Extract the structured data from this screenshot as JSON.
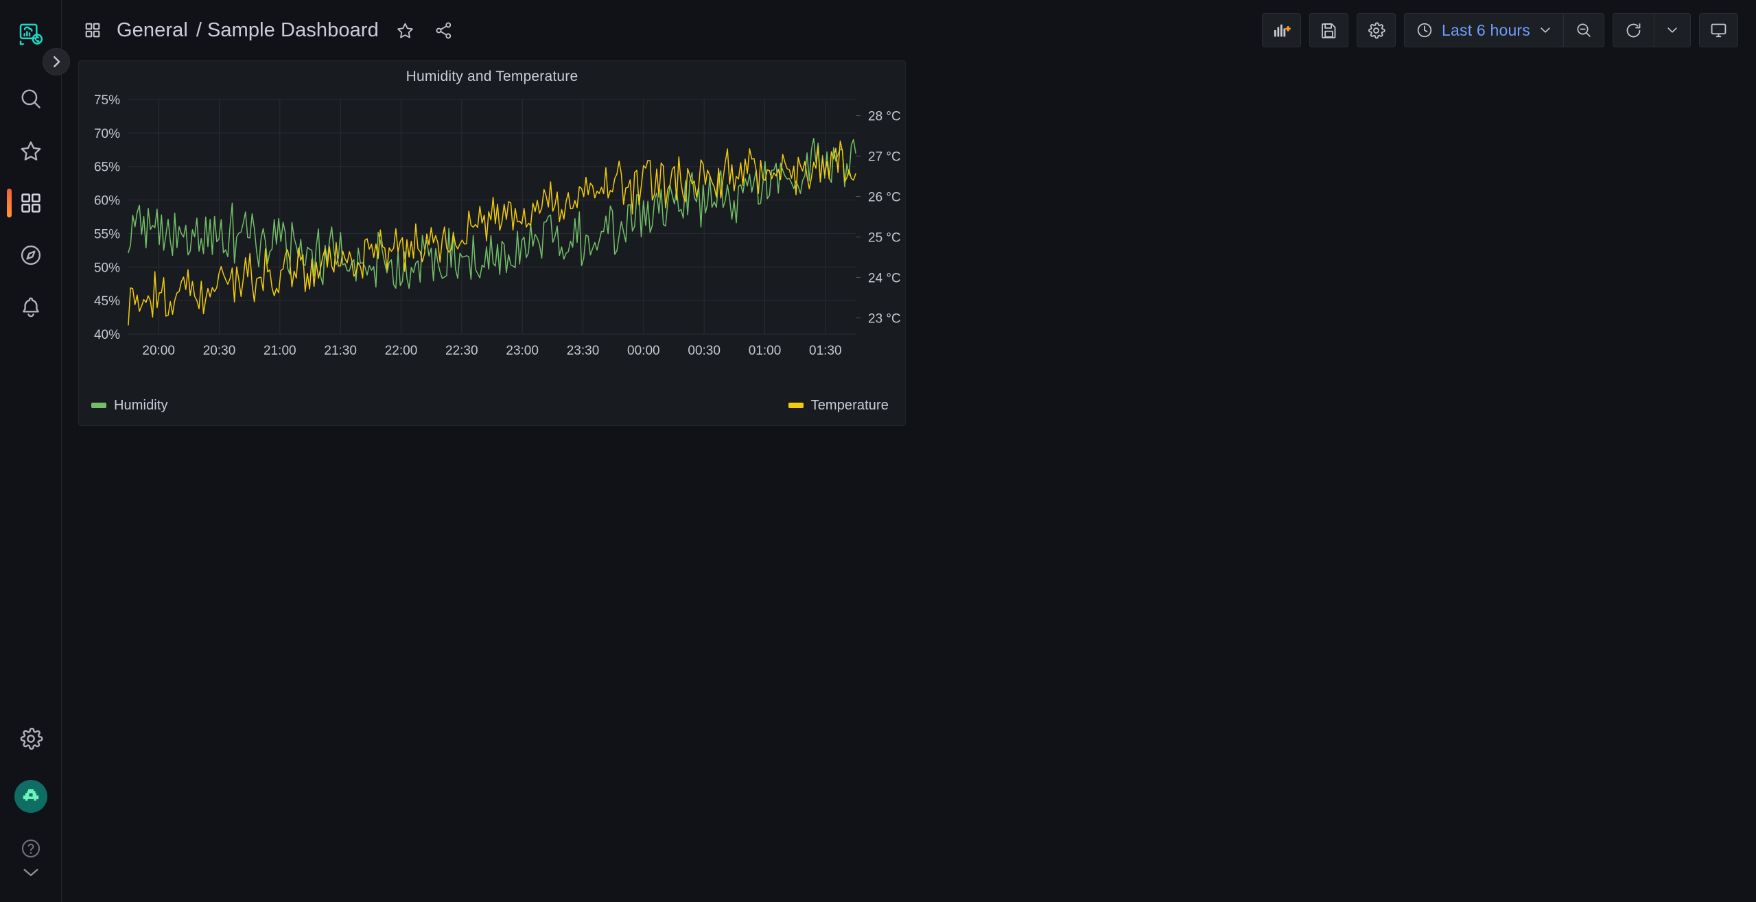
{
  "nav": {
    "logo_icon": "grafana-logo-icon",
    "expand_button_icon": "chevron-right-icon",
    "items": [
      {
        "id": "search",
        "label": "Search",
        "icon": "search-icon",
        "active": false
      },
      {
        "id": "starred",
        "label": "Starred",
        "icon": "star-icon",
        "active": false
      },
      {
        "id": "dashboards",
        "label": "Dashboards",
        "icon": "apps-grid-icon",
        "active": true
      },
      {
        "id": "explore",
        "label": "Explore",
        "icon": "compass-icon",
        "active": false
      },
      {
        "id": "alerting",
        "label": "Alerting",
        "icon": "bell-icon",
        "active": false
      }
    ],
    "bottom": [
      {
        "id": "configuration",
        "label": "Configuration",
        "icon": "gear-icon"
      },
      {
        "id": "profile",
        "label": "Profile",
        "icon": "avatar-robot-icon"
      },
      {
        "id": "help",
        "label": "Help",
        "icon": "question-circle-icon"
      }
    ]
  },
  "header": {
    "grid_icon": "apps-grid-icon",
    "folder": "General",
    "separator": "/",
    "title": "Sample Dashboard",
    "star_icon": "star-outline-icon",
    "share_icon": "share-nodes-icon"
  },
  "toolbar": {
    "add_panel": {
      "label": "Add panel",
      "icon": "add-panel-icon"
    },
    "save": {
      "label": "Save dashboard",
      "icon": "save-floppy-icon"
    },
    "settings": {
      "label": "Dashboard settings",
      "icon": "gear-icon"
    },
    "time_range": {
      "label": "Last 6 hours",
      "icon": "clock-icon",
      "chevron": "chevron-down-icon"
    },
    "zoom_out": {
      "label": "Zoom out time range",
      "icon": "zoom-out-icon"
    },
    "refresh": {
      "label": "Refresh dashboard",
      "icon": "refresh-icon",
      "chevron": "chevron-down-icon"
    },
    "kiosk": {
      "label": "Cycle view mode",
      "icon": "monitor-icon"
    }
  },
  "panel": {
    "title": "Humidity and Temperature",
    "legend": [
      {
        "name": "Humidity",
        "color": "#73bf69",
        "align": "left"
      },
      {
        "name": "Temperature",
        "color": "#f2cc0c",
        "align": "right"
      }
    ]
  },
  "chart_data": {
    "type": "line",
    "title": "Humidity and Temperature",
    "xlabel": "",
    "grid": true,
    "legend_position": "bottom",
    "x_ticks": [
      "20:00",
      "20:30",
      "21:00",
      "21:30",
      "22:00",
      "22:30",
      "23:00",
      "23:30",
      "00:00",
      "00:30",
      "01:00",
      "01:30"
    ],
    "axes": [
      {
        "id": "left",
        "ylabel": "Humidity",
        "unit": "%",
        "ylim": [
          40,
          75
        ],
        "ticks": [
          40,
          45,
          50,
          55,
          60,
          65,
          70,
          75
        ],
        "tick_labels": [
          "40%",
          "45%",
          "50%",
          "55%",
          "60%",
          "65%",
          "70%",
          "75%"
        ]
      },
      {
        "id": "right",
        "ylabel": "Temperature",
        "unit": "°C",
        "ylim": [
          22.6,
          28.4
        ],
        "ticks": [
          23,
          24,
          25,
          26,
          27,
          28
        ],
        "tick_labels": [
          "23 °C",
          "24 °C",
          "25 °C",
          "26 °C",
          "27 °C",
          "28 °C"
        ]
      }
    ],
    "series": [
      {
        "name": "Humidity",
        "color": "#73bf69",
        "axis": "left",
        "unit": "%",
        "noise": 3.6,
        "seed": 7,
        "trend": [
          [
            0.0,
            57.0
          ],
          [
            0.03,
            56.6
          ],
          [
            0.06,
            55.8
          ],
          [
            0.1,
            55.0
          ],
          [
            0.14,
            54.3
          ],
          [
            0.18,
            53.6
          ],
          [
            0.22,
            53.0
          ],
          [
            0.26,
            52.4
          ],
          [
            0.3,
            52.0
          ],
          [
            0.34,
            51.6
          ],
          [
            0.38,
            51.4
          ],
          [
            0.42,
            51.4
          ],
          [
            0.46,
            51.6
          ],
          [
            0.5,
            52.0
          ],
          [
            0.54,
            52.6
          ],
          [
            0.58,
            53.4
          ],
          [
            0.62,
            54.4
          ],
          [
            0.66,
            55.6
          ],
          [
            0.7,
            57.0
          ],
          [
            0.74,
            58.4
          ],
          [
            0.78,
            59.8
          ],
          [
            0.82,
            61.2
          ],
          [
            0.86,
            62.4
          ],
          [
            0.9,
            63.4
          ],
          [
            0.94,
            64.4
          ],
          [
            0.97,
            65.2
          ],
          [
            1.0,
            65.8
          ]
        ]
      },
      {
        "name": "Temperature",
        "color": "#f2cc0c",
        "axis": "right",
        "unit": "°C",
        "noise": 2.9,
        "seed": 23,
        "trend_as_left_scale": [
          [
            0.0,
            44.6
          ],
          [
            0.03,
            45.2
          ],
          [
            0.06,
            46.0
          ],
          [
            0.1,
            46.8
          ],
          [
            0.14,
            47.6
          ],
          [
            0.18,
            48.4
          ],
          [
            0.22,
            49.2
          ],
          [
            0.26,
            50.2
          ],
          [
            0.3,
            51.2
          ],
          [
            0.34,
            52.2
          ],
          [
            0.38,
            53.2
          ],
          [
            0.42,
            54.4
          ],
          [
            0.46,
            55.6
          ],
          [
            0.5,
            56.8
          ],
          [
            0.54,
            58.0
          ],
          [
            0.58,
            59.2
          ],
          [
            0.62,
            60.4
          ],
          [
            0.66,
            61.4
          ],
          [
            0.7,
            62.2
          ],
          [
            0.74,
            62.8
          ],
          [
            0.78,
            63.2
          ],
          [
            0.82,
            63.6
          ],
          [
            0.86,
            64.2
          ],
          [
            0.9,
            64.8
          ],
          [
            0.94,
            65.2
          ],
          [
            0.97,
            65.6
          ],
          [
            1.0,
            66.0
          ]
        ]
      }
    ],
    "n_points": 330
  }
}
